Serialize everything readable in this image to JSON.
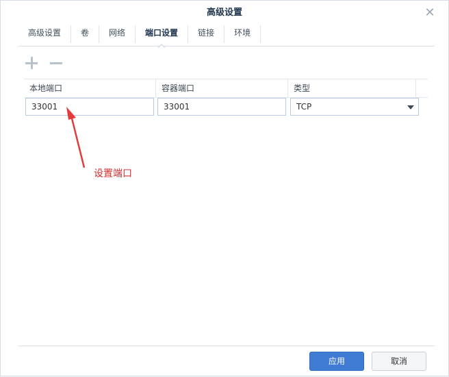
{
  "dialog": {
    "title": "高级设置",
    "close_icon": "close-icon"
  },
  "tabs": [
    {
      "label": "高级设置",
      "active": false
    },
    {
      "label": "卷",
      "active": false
    },
    {
      "label": "网络",
      "active": false
    },
    {
      "label": "端口设置",
      "active": true
    },
    {
      "label": "链接",
      "active": false
    },
    {
      "label": "环境",
      "active": false
    }
  ],
  "toolbar": {
    "add_icon": "plus-icon",
    "remove_icon": "minus-icon"
  },
  "table": {
    "columns": [
      "本地端口",
      "容器端口",
      "类型"
    ],
    "rows": [
      {
        "local_port": "33001",
        "container_port": "33001",
        "type": "TCP"
      }
    ]
  },
  "annotation": {
    "text": "设置端口",
    "color": "#d42c2c"
  },
  "footer": {
    "apply_label": "应用",
    "cancel_label": "取消"
  },
  "colors": {
    "primary_button": "#3f7bd3",
    "title": "#22384f"
  }
}
